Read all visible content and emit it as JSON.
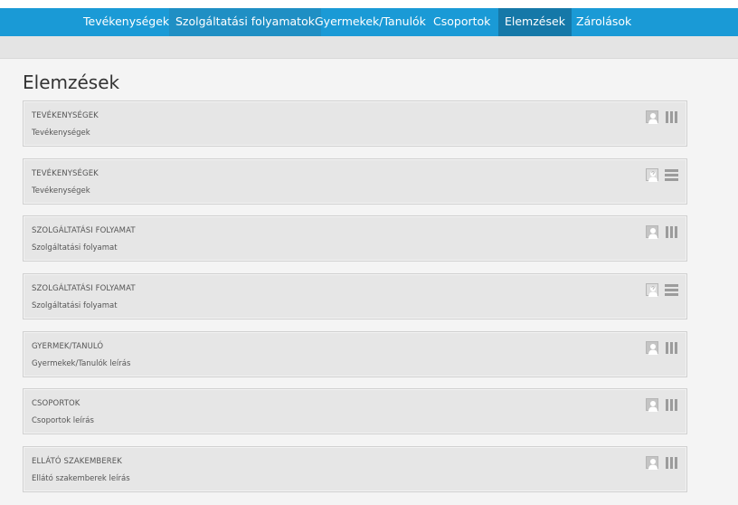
{
  "nav": {
    "items": [
      {
        "label": "Tevékenységek",
        "active": false
      },
      {
        "label": "Szolgáltatási folyamatok",
        "active": false
      },
      {
        "label": "Gyermekek/Tanulók",
        "active": false
      },
      {
        "label": "Csoportok",
        "active": false
      },
      {
        "label": "Elemzések",
        "active": true
      },
      {
        "label": "Zárolások",
        "active": false
      }
    ]
  },
  "page": {
    "title": "Elemzések"
  },
  "cards": [
    {
      "title": "TEVÉKENYSÉGEK",
      "subtitle": "Tevékenységek",
      "user_icon": "user-icon",
      "view_icon": "columns-icon"
    },
    {
      "title": "TEVÉKENYSÉGEK",
      "subtitle": "Tevékenységek",
      "user_icon": "user-help-icon",
      "view_icon": "list-icon"
    },
    {
      "title": "SZOLGÁLTATÁSI FOLYAMAT",
      "subtitle": "Szolgáltatási folyamat",
      "user_icon": "user-icon",
      "view_icon": "columns-icon"
    },
    {
      "title": "SZOLGÁLTATÁSI FOLYAMAT",
      "subtitle": "Szolgáltatási folyamat",
      "user_icon": "user-help-icon",
      "view_icon": "list-icon"
    },
    {
      "title": "GYERMEK/TANULÓ",
      "subtitle": "Gyermekek/Tanulók leírás",
      "user_icon": "user-icon",
      "view_icon": "columns-icon"
    },
    {
      "title": "CSOPORTOK",
      "subtitle": "Csoportok leírás",
      "user_icon": "user-icon",
      "view_icon": "columns-icon"
    },
    {
      "title": "ELLÁTÓ SZAKEMBEREK",
      "subtitle": "Ellátó szakemberek leírás",
      "user_icon": "user-icon",
      "view_icon": "columns-icon"
    }
  ],
  "colors": {
    "nav_bg": "#1a9ad6",
    "nav_active_bg": "#1578a8",
    "card_bg": "#e6e6e6",
    "page_bg": "#f4f4f4"
  }
}
